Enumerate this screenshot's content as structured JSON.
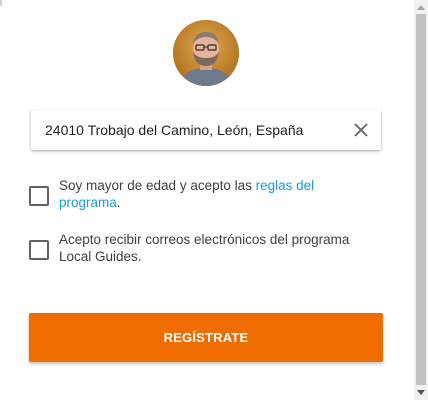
{
  "profile": {
    "avatar_icon": "user-avatar-photo"
  },
  "address": {
    "value": "24010 Trobajo del Camino, León, España",
    "clear_icon": "close-icon"
  },
  "consent": {
    "age_text": "Soy mayor de edad y acepto las ",
    "rules_link": "reglas del programa",
    "age_suffix": ".",
    "emails_text": "Acepto recibir correos electrónicos del programa Local Guides."
  },
  "actions": {
    "register_label": "REGÍSTRATE"
  },
  "colors": {
    "accent": "#ef6c00",
    "link": "#1a9bd8"
  }
}
